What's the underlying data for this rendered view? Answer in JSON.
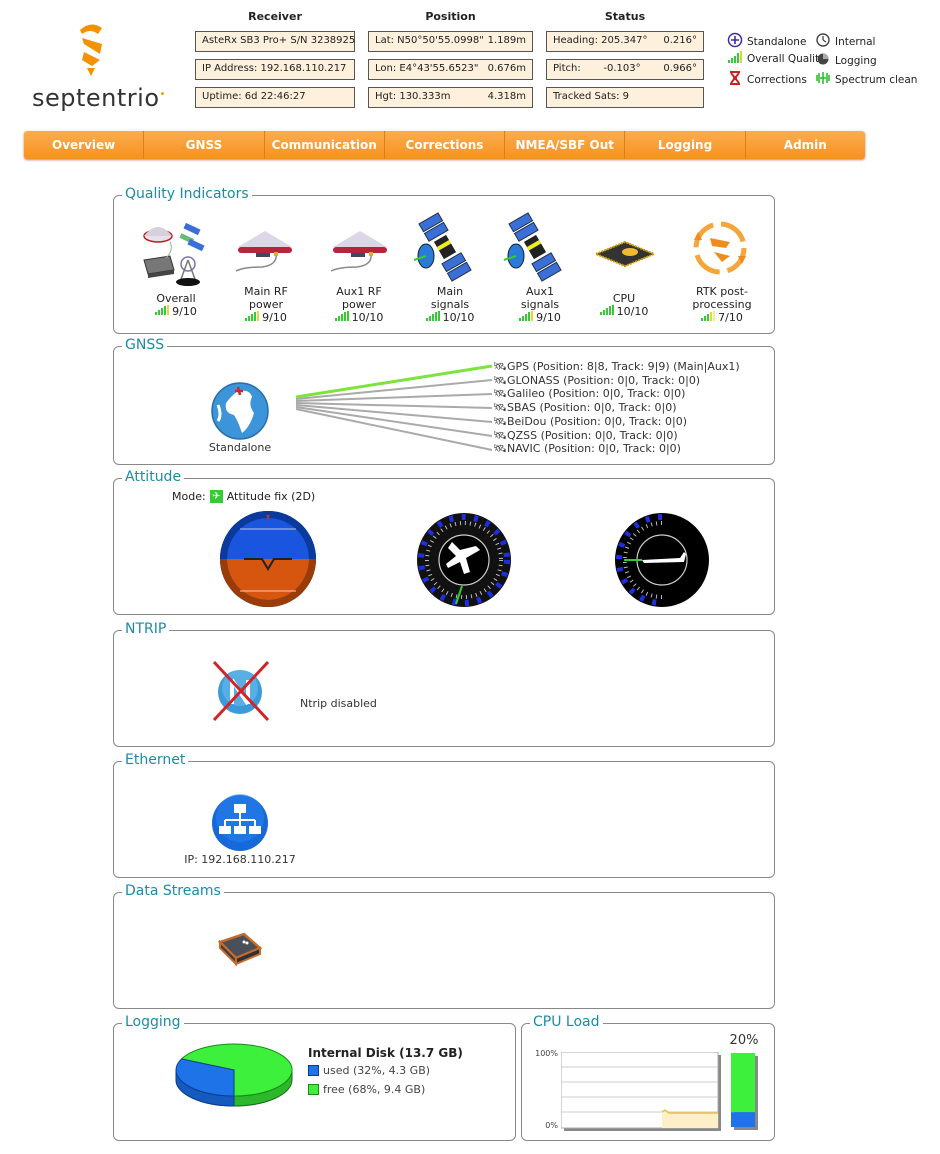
{
  "header": {
    "brand": "septentrio",
    "receiver": {
      "title": "Receiver",
      "model": "AsteRx SB3 Pro+ S/N 3238925",
      "ip": "IP Address: 192.168.110.217",
      "uptime": "Uptime: 6d 22:46:27"
    },
    "position": {
      "title": "Position",
      "lat_label": "Lat:  N50°50'55.0998\"",
      "lat_acc": "1.189m",
      "lon_label": "Lon: E4°43'55.6523\"",
      "lon_acc": "0.676m",
      "hgt_label": "Hgt: 130.333m",
      "hgt_acc": "4.318m"
    },
    "status": {
      "title": "Status",
      "heading_label": "Heading: 205.347°",
      "heading_acc": "0.216°",
      "pitch_label": "Pitch:",
      "pitch_value": "-0.103°",
      "pitch_acc": "0.966°",
      "tracked": "Tracked Sats: 9"
    },
    "legend": [
      {
        "icon": "standalone-icon",
        "label": "Standalone"
      },
      {
        "icon": "clock-icon",
        "label": "Internal"
      },
      {
        "icon": "signal-bars-icon",
        "label": "Overall Quality"
      },
      {
        "icon": "logging-icon",
        "label": "Logging"
      },
      {
        "icon": "corrections-icon",
        "label": "Corrections"
      },
      {
        "icon": "spectrum-icon",
        "label": "Spectrum clean"
      }
    ]
  },
  "nav": [
    "Overview",
    "GNSS",
    "Communication",
    "Corrections",
    "NMEA/SBF Out",
    "Logging",
    "Admin"
  ],
  "colors": {
    "accent": "#f6921e",
    "panel_title": "#1b8ba6",
    "good": "#22cc22",
    "used": "#1e73e8",
    "free": "#3cf03c"
  },
  "quality": {
    "title": "Quality Indicators",
    "items": [
      {
        "label1": "Overall",
        "label2": "",
        "score": "9/10",
        "value": 9
      },
      {
        "label1": "Main RF",
        "label2": "power",
        "score": "9/10",
        "value": 9
      },
      {
        "label1": "Aux1 RF",
        "label2": "power",
        "score": "10/10",
        "value": 10
      },
      {
        "label1": "Main",
        "label2": "signals",
        "score": "10/10",
        "value": 10
      },
      {
        "label1": "Aux1",
        "label2": "signals",
        "score": "9/10",
        "value": 9
      },
      {
        "label1": "",
        "label2": "CPU",
        "score": "10/10",
        "value": 10
      },
      {
        "label1": "RTK post-",
        "label2": "processing",
        "score": "7/10",
        "value": 7
      }
    ]
  },
  "gnss": {
    "title": "GNSS",
    "mode": "Standalone",
    "constellations": [
      "GPS (Position: 8|8, Track: 9|9) (Main|Aux1)",
      "GLONASS (Position: 0|0, Track: 0|0)",
      "Galileo (Position: 0|0, Track: 0|0)",
      "SBAS (Position: 0|0, Track: 0|0)",
      "BeiDou (Position: 0|0, Track: 0|0)",
      "QZSS (Position: 0|0, Track: 0|0)",
      "NAVIC (Position: 0|0, Track: 0|0)"
    ]
  },
  "attitude": {
    "title": "Attitude",
    "mode_label": "Mode:",
    "mode_value": "Attitude fix (2D)",
    "heading_deg": 205.347,
    "pitch_deg": -0.103
  },
  "ntrip": {
    "title": "NTRIP",
    "status": "Ntrip disabled"
  },
  "ethernet": {
    "title": "Ethernet",
    "ip": "IP: 192.168.110.217"
  },
  "streams": {
    "title": "Data Streams"
  },
  "logging": {
    "title": "Logging",
    "disk_title": "Internal Disk (13.7 GB)",
    "used_label": "used (32%, 4.3 GB)",
    "free_label": "free (68%, 9.4 GB)",
    "used_pct": 32,
    "free_pct": 68
  },
  "cpu": {
    "title": "CPU Load",
    "current": "20%",
    "current_pct": 20,
    "y_max_label": "100%",
    "y_min_label": "0%"
  }
}
